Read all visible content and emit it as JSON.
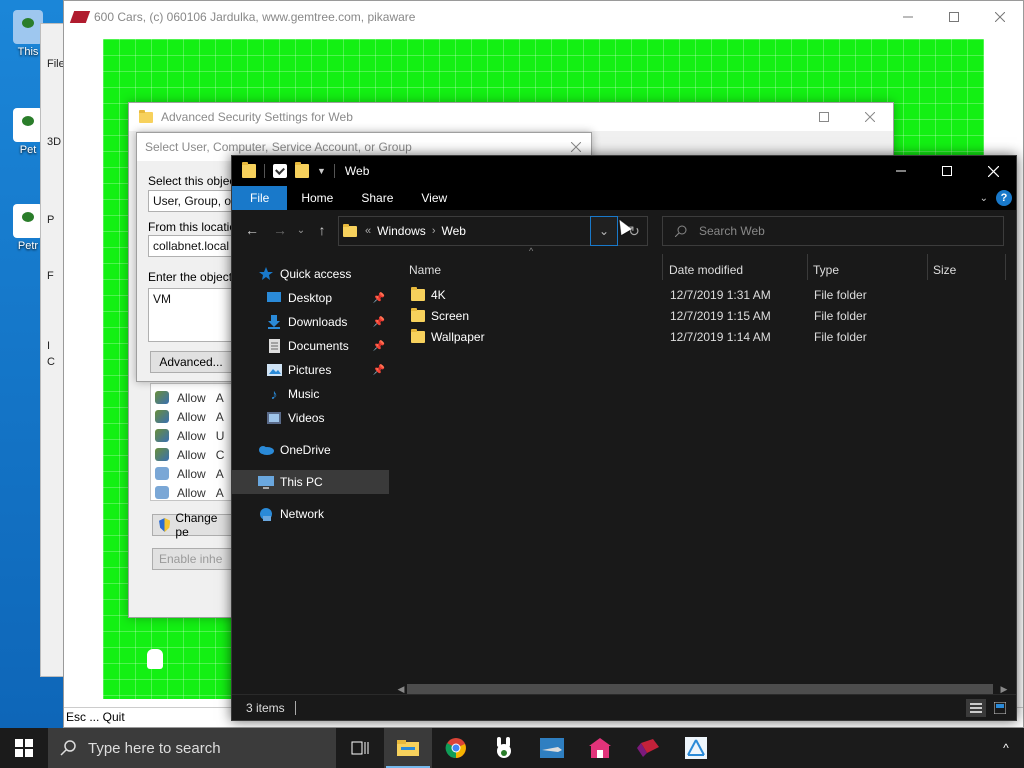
{
  "desktop": {
    "icons": [
      {
        "label": "This"
      },
      {
        "label": "Pet"
      },
      {
        "label": "Petr"
      }
    ],
    "bg_window": {
      "items": [
        "File",
        "3D",
        "P",
        "F",
        "I",
        "C"
      ]
    }
  },
  "game_window": {
    "title": "600 Cars, (c) 060106 Jardulka, www.gemtree.com, pikaware",
    "status": "Esc ... Quit",
    "bg_color": "#13f013"
  },
  "security_window": {
    "title": "Advanced Security Settings for Web",
    "permissions": [
      "Allow",
      "Allow",
      "Allow",
      "Allow",
      "Allow",
      "Allow"
    ],
    "perm_suffix": [
      "A",
      "A",
      "U",
      "C",
      "A",
      "A"
    ],
    "change_permissions_label": "Change pe",
    "enable_inheritance_label": "Enable inhe"
  },
  "select_user_dialog": {
    "title": "Select User, Computer, Service Account, or Group",
    "object_type_label": "Select this object",
    "object_type_value": "User, Group, or B",
    "location_label": "From this location",
    "location_value": "collabnet.local",
    "names_label": "Enter the object n",
    "names_value": "VM",
    "advanced_label": "Advanced..."
  },
  "explorer": {
    "title": "Web",
    "ribbon_tabs": [
      "File",
      "Home",
      "Share",
      "View"
    ],
    "breadcrumb": [
      "Windows",
      "Web"
    ],
    "search_placeholder": "Search Web",
    "nav": {
      "quick_access": "Quick access",
      "items": [
        {
          "label": "Desktop",
          "pinned": true
        },
        {
          "label": "Downloads",
          "pinned": true
        },
        {
          "label": "Documents",
          "pinned": true
        },
        {
          "label": "Pictures",
          "pinned": true
        },
        {
          "label": "Music",
          "pinned": false
        },
        {
          "label": "Videos",
          "pinned": false
        }
      ],
      "onedrive": "OneDrive",
      "this_pc": "This PC",
      "network": "Network"
    },
    "columns": {
      "name": "Name",
      "date": "Date modified",
      "type": "Type",
      "size": "Size"
    },
    "files": [
      {
        "name": "4K",
        "date": "12/7/2019 1:31 AM",
        "type": "File folder"
      },
      {
        "name": "Screen",
        "date": "12/7/2019 1:15 AM",
        "type": "File folder"
      },
      {
        "name": "Wallpaper",
        "date": "12/7/2019 1:14 AM",
        "type": "File folder"
      }
    ],
    "status": "3 items",
    "accent": "#1979ca"
  },
  "taskbar": {
    "search_placeholder": "Type here to search",
    "apps": [
      "task-view-icon",
      "file-explorer-icon",
      "chrome-icon",
      "bunny-app-icon",
      "shark-app-icon",
      "house-app-icon",
      "cars-app-icon",
      "network-app-icon"
    ]
  }
}
